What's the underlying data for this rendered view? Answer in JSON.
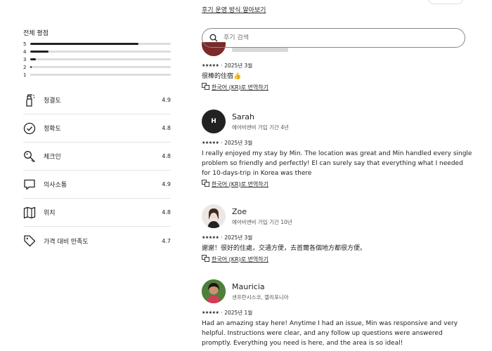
{
  "header": {
    "review_policy_link": "후기 운영 방식 알아보기"
  },
  "overall": {
    "title": "전체 평점",
    "distribution": [
      {
        "star": "5",
        "fraction": 0.77
      },
      {
        "star": "4",
        "fraction": 0.13
      },
      {
        "star": "3",
        "fraction": 0.04
      },
      {
        "star": "2",
        "fraction": 0.01
      },
      {
        "star": "1",
        "fraction": 0.0
      }
    ]
  },
  "categories": [
    {
      "icon": "spray-bottle-icon",
      "label": "청결도",
      "score": "4.9"
    },
    {
      "icon": "check-circle-icon",
      "label": "정확도",
      "score": "4.8"
    },
    {
      "icon": "key-icon",
      "label": "체크인",
      "score": "4.8"
    },
    {
      "icon": "chat-bubble-icon",
      "label": "의사소통",
      "score": "4.9"
    },
    {
      "icon": "map-icon",
      "label": "위치",
      "score": "4.8"
    },
    {
      "icon": "price-tag-icon",
      "label": "가격 대비 만족도",
      "score": "4.7"
    }
  ],
  "search": {
    "placeholder": "후기 검색"
  },
  "reviews": [
    {
      "name": "",
      "date": "2025년 3월",
      "text": "很棒的住宿👍",
      "translate": "한국어 (KR)로 번역하기"
    },
    {
      "name": "Sarah",
      "initial": "H",
      "member": "에어비앤비 가입 기간 4년",
      "date": "2025년 3월",
      "text": "I really enjoyed my stay by Min. The location was great and Min handled every single problem so friendly and perfectly! El can surely say that everything what I needed for 10-days-trip in Korea was there",
      "translate": "한국어 (KR)로 번역하기"
    },
    {
      "name": "Zoe",
      "member": "에어비앤비 가입 기간 10년",
      "date": "2025년 3월",
      "text": "謝謝！很好的住處，交通方便，去首爾各個地方都很方便。",
      "translate": "한국어 (KR)로 번역하기"
    },
    {
      "name": "Mauricia",
      "member": "샌프란시스코, 캘리포니아",
      "date": "2025년 1월",
      "text": "Had an amazing stay here! Anytime I had an issue, Min was responsive and very helpful. Instructions were clear, and any follow up questions were answered promptly. Everything you need is here, and the area is so ideal!"
    }
  ],
  "colors": {
    "text": "#222222",
    "bar_bg": "#dddddd",
    "border": "#e4e4e4"
  }
}
